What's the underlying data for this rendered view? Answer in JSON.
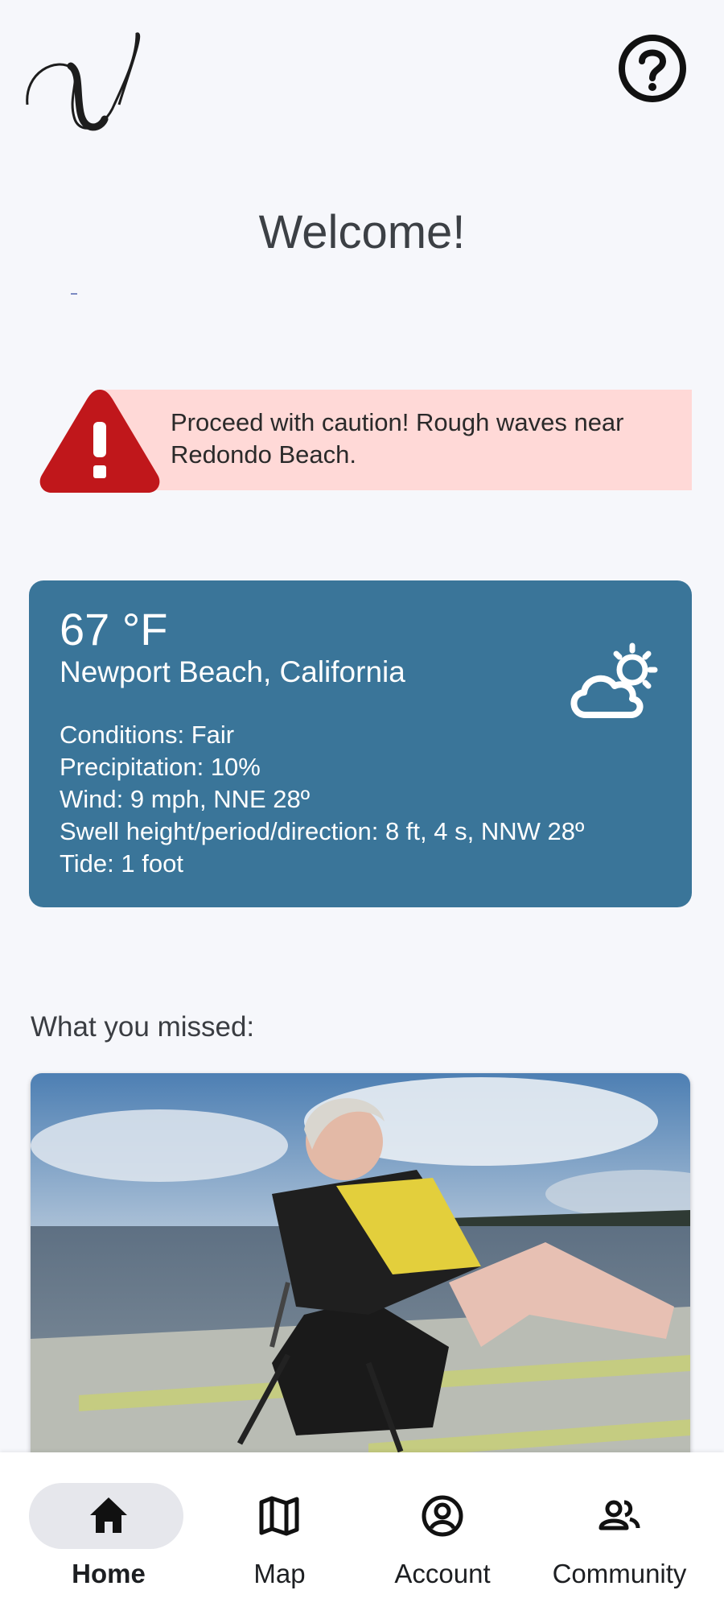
{
  "header": {
    "logo_icon": "script-v-logo-icon",
    "help_icon": "help-circle-icon"
  },
  "welcome": {
    "title": "Welcome!"
  },
  "alert": {
    "icon": "warning-triangle-icon",
    "text": "Proceed with caution! Rough waves near Redondo Beach.",
    "background": "#ffd9d7",
    "icon_color": "#c0171b"
  },
  "weather": {
    "temperature": "67 °F",
    "location": "Newport Beach, California",
    "icon": "partly-sunny-icon",
    "details": [
      "Conditions: Fair",
      "Precipitation: 10%",
      "Wind: 9 mph, NNE 28º",
      "Swell height/period/direction: 8 ft, 4 s, NNW 28º",
      "Tide: 1 foot"
    ],
    "background": "#3a7599"
  },
  "missed": {
    "label": "What you missed:"
  },
  "nav": {
    "items": [
      {
        "label": "Home",
        "icon": "home-icon",
        "active": true
      },
      {
        "label": "Map",
        "icon": "map-icon",
        "active": false
      },
      {
        "label": "Account",
        "icon": "account-circle-icon",
        "active": false
      },
      {
        "label": "Community",
        "icon": "community-icon",
        "active": false
      }
    ]
  }
}
